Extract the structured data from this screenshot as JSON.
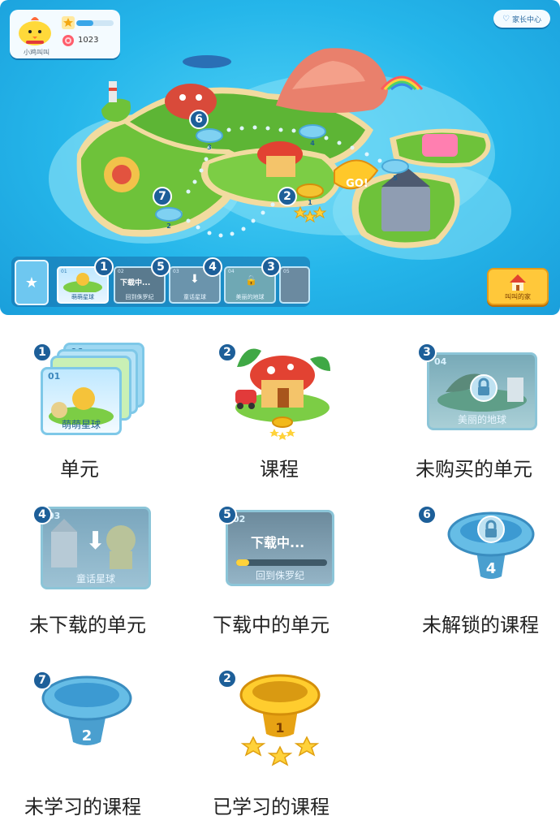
{
  "profile": {
    "nickname": "小鸡叫叫",
    "coins": "1023",
    "progress": 0.45
  },
  "parent_center": {
    "label": "家长中心"
  },
  "map": {
    "go_label": "GO!",
    "home_label": "叫叫的家",
    "lesson_pads": [
      {
        "number": "3"
      },
      {
        "number": "4"
      },
      {
        "number": "5"
      },
      {
        "number": "2"
      },
      {
        "number": "1"
      }
    ],
    "callouts": [
      "6",
      "2",
      "7"
    ]
  },
  "units": [
    {
      "number": "01",
      "name": "萌萌星球",
      "callout": "1"
    },
    {
      "number": "02",
      "name": "回到侏罗纪",
      "status": "下载中...",
      "callout": "5"
    },
    {
      "number": "03",
      "name": "童话星球",
      "callout": "4"
    },
    {
      "number": "04",
      "name": "美丽的地球",
      "callout": "3"
    },
    {
      "number": "05",
      "name": ""
    }
  ],
  "legend": [
    {
      "badge": "1",
      "label": "单元",
      "card_number": "01",
      "card_name": "萌萌星球",
      "stack_top": "06"
    },
    {
      "badge": "2",
      "label": "课程"
    },
    {
      "badge": "3",
      "label": "未购买的单元",
      "card_number": "04",
      "card_name": "美丽的地球"
    },
    {
      "badge": "4",
      "label": "未下载的单元",
      "card_number": "03",
      "card_name": "童话星球"
    },
    {
      "badge": "5",
      "label": "下载中的单元",
      "card_number": "02",
      "card_name": "回到侏罗纪",
      "status": "下载中..."
    },
    {
      "badge": "6",
      "label": "未解锁的课程",
      "pad_number": "4"
    },
    {
      "badge": "7",
      "label": "未学习的课程",
      "pad_number": "2"
    },
    {
      "badge": "2",
      "label": "已学习的课程",
      "pad_number": "1"
    }
  ],
  "colors": {
    "sea": "#25b6ea",
    "badge": "#1d5f99",
    "grass": "#6ec23a",
    "gold": "#f2b91a"
  }
}
